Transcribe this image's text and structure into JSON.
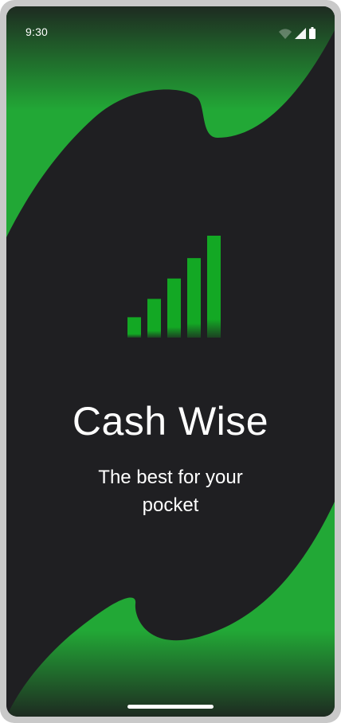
{
  "status_bar": {
    "time": "9:30",
    "icons": [
      "wifi-icon",
      "cellular-signal-icon",
      "battery-icon"
    ]
  },
  "app": {
    "title": "Cash Wise",
    "tagline": "The best for your pocket"
  },
  "colors": {
    "background": "#1f1f22",
    "accent_green": "#22a836",
    "accent_green_dark": "#1e3323",
    "logo_green": "#13a824",
    "text": "#ffffff"
  },
  "logo": {
    "name": "growth-bars-logo",
    "bar_levels": [
      0.2,
      0.38,
      0.58,
      0.78,
      1.0
    ]
  }
}
